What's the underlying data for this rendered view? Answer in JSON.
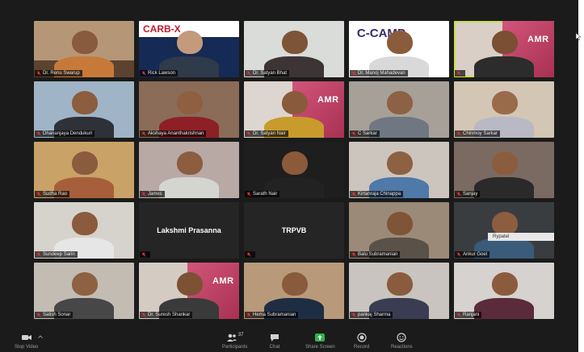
{
  "tiles": [
    {
      "name": "Dr. Renu Swarup",
      "bg": "#b59777",
      "skin": "#8a5a3e",
      "shirt": "#c7793a",
      "variant": "shelf"
    },
    {
      "name": "Rick Lawson",
      "bg": "#152a55",
      "skin": "#c49a7c",
      "shirt": "#2f3a4a",
      "variant": "brand",
      "brand_text": "CARB-X"
    },
    {
      "name": "Dr. Satyan Bhat",
      "bg": "#d9dcd8",
      "skin": "#7d5438",
      "shirt": "#3d3535",
      "variant": "plain"
    },
    {
      "name": "Dr. Manoj Mahadevan",
      "bg": "#ffffff",
      "skin": "#8a5c3c",
      "shirt": "#d9d9d9",
      "variant": "ccamp",
      "brand_text": "C-CAMP"
    },
    {
      "name": "",
      "bg": "#d9cfc7",
      "skin": "#7a4f33",
      "shirt": "#2c2c2c",
      "variant": "banner",
      "banner_text": "AMR",
      "active": true
    },
    {
      "name": "Dhananjaya Dendukuri",
      "bg": "#9fb4c6",
      "skin": "#8c5d3e",
      "shirt": "#2e3138",
      "variant": "plain"
    },
    {
      "name": "Akshaya Ananthakrishnan",
      "bg": "#8a6c58",
      "skin": "#8e5f41",
      "shirt": "#8d1f27",
      "variant": "plain"
    },
    {
      "name": "Dr. Satyan Nair",
      "bg": "#ddd5cf",
      "skin": "#8a5a3c",
      "shirt": "#c89b2c",
      "variant": "banner",
      "banner_text": "AMR"
    },
    {
      "name": "C Sarkar",
      "bg": "#a7a098",
      "skin": "#8d6244",
      "shirt": "#6f7882",
      "variant": "plain"
    },
    {
      "name": "Chinmoy Sarkar",
      "bg": "#d4c6b4",
      "skin": "#9a6b4b",
      "shirt": "#b9b9c4",
      "variant": "plain"
    },
    {
      "name": "Sudha Rao",
      "bg": "#c9a268",
      "skin": "#8b5b3e",
      "shirt": "#a75f3b",
      "variant": "plain"
    },
    {
      "name": "James",
      "bg": "#b9a9a5",
      "skin": "#8c5d3f",
      "shirt": "#d4d4d0",
      "variant": "plain"
    },
    {
      "name": "Sarath Nair",
      "bg": "#1e1e1e",
      "skin": "#8a5a3b",
      "shirt": "#222222",
      "variant": "plain"
    },
    {
      "name": "Kirtanraja Chinappa",
      "bg": "#ccc5bd",
      "skin": "#8e6142",
      "shirt": "#4f79a8",
      "variant": "plain"
    },
    {
      "name": "Sanjay",
      "bg": "#7b6a62",
      "skin": "#8b5d3f",
      "shirt": "#2a2a2a",
      "variant": "plain"
    },
    {
      "name": "Sundeep Sarin",
      "bg": "#d6d2cc",
      "skin": "#8a5b3c",
      "shirt": "#e6e6e6",
      "variant": "plain"
    },
    {
      "name": "",
      "center": "Lakshmi Prasanna",
      "variant": "nocam"
    },
    {
      "name": "",
      "center": "TRPVB",
      "variant": "nocam"
    },
    {
      "name": "Balu Subramanian",
      "bg": "#9b8a78",
      "skin": "#7f5437",
      "shirt": "#5a5148",
      "variant": "plain"
    },
    {
      "name": "Ankur Goel",
      "bg": "#3a3d40",
      "skin": "#8d5d40",
      "shirt": "#3a5b7a",
      "variant": "plain",
      "hover": "Rypatel"
    },
    {
      "name": "Satish Sonar",
      "bg": "#c2bcb3",
      "skin": "#8d6142",
      "shirt": "#474747",
      "variant": "plain"
    },
    {
      "name": "Dr. Suresh Shankar",
      "bg": "#d4cbc3",
      "skin": "#7c5134",
      "shirt": "#3a3a3a",
      "variant": "banner",
      "banner_text": "AMR"
    },
    {
      "name": "Hema Subramanian",
      "bg": "#b89a7a",
      "skin": "#8a5a3c",
      "shirt": "#1f2d44",
      "variant": "plain"
    },
    {
      "name": "pankaj Sharma",
      "bg": "#c9c4bf",
      "skin": "#8a5c3d",
      "shirt": "#3a3d52",
      "variant": "plain"
    },
    {
      "name": "Ranjani",
      "bg": "#d5d2cf",
      "skin": "#8b5b3d",
      "shirt": "#5a2b3a",
      "variant": "plain"
    }
  ],
  "toolbar": {
    "stop_video": "Stop Video",
    "participants": "Participants",
    "participant_count": "37",
    "chat": "Chat",
    "share_screen": "Share Screen",
    "record": "Record",
    "reactions": "Reactions",
    "accent": "#2fb24b"
  }
}
